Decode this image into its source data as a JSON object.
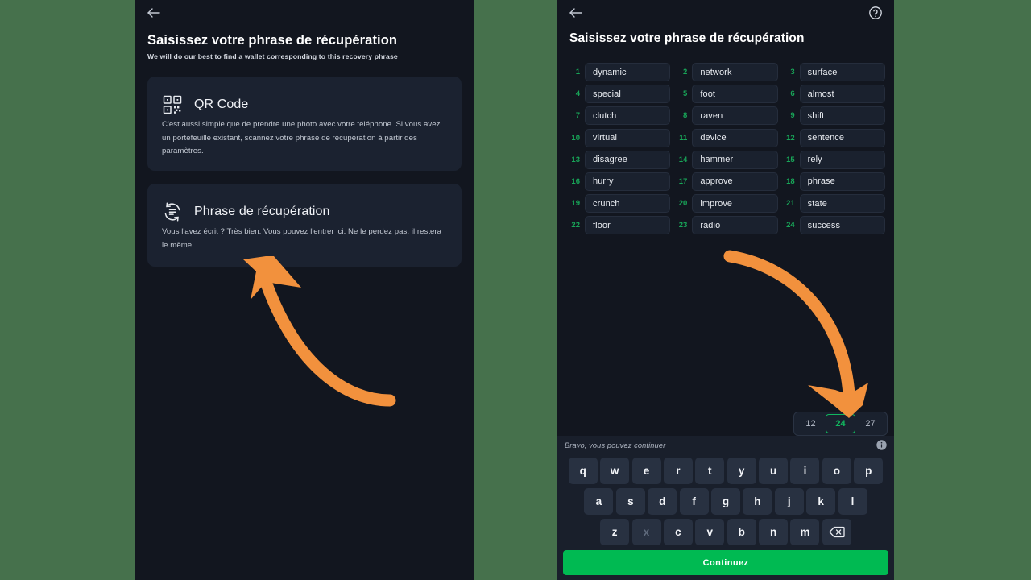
{
  "theme": {
    "background": "#46714c",
    "panel_bg": "#12161f",
    "card_bg": "#1b2230",
    "accent_green": "#00ba52",
    "number_green": "#18a558",
    "annotation_orange": "#f2913d",
    "key_bg": "#283141"
  },
  "left_panel": {
    "back_icon": "back-arrow-icon",
    "title": "Saisissez votre phrase de récupération",
    "subtitle": "We will do our best to find a wallet corresponding to this recovery phrase",
    "cards": [
      {
        "icon": "qr-code-icon",
        "title": "QR Code",
        "body": "C'est aussi simple que de prendre une photo avec votre téléphone. Si vous avez un portefeuille existant, scannez votre phrase de récupération à partir des paramètres."
      },
      {
        "icon": "recovery-phrase-icon",
        "title": "Phrase de récupération",
        "body": "Vous l'avez écrit ? Très bien. Vous pouvez l'entrer ici. Ne le perdez pas, il restera le même."
      }
    ]
  },
  "right_panel": {
    "back_icon": "back-arrow-icon",
    "help_icon": "help-circle-icon",
    "title": "Saisissez votre phrase de récupération",
    "words": [
      {
        "num": "1",
        "word": "dynamic"
      },
      {
        "num": "2",
        "word": "network"
      },
      {
        "num": "3",
        "word": "surface"
      },
      {
        "num": "4",
        "word": "special"
      },
      {
        "num": "5",
        "word": "foot"
      },
      {
        "num": "6",
        "word": "almost"
      },
      {
        "num": "7",
        "word": "clutch"
      },
      {
        "num": "8",
        "word": "raven"
      },
      {
        "num": "9",
        "word": "shift"
      },
      {
        "num": "10",
        "word": "virtual"
      },
      {
        "num": "11",
        "word": "device"
      },
      {
        "num": "12",
        "word": "sentence"
      },
      {
        "num": "13",
        "word": "disagree"
      },
      {
        "num": "14",
        "word": "hammer"
      },
      {
        "num": "15",
        "word": "rely"
      },
      {
        "num": "16",
        "word": "hurry"
      },
      {
        "num": "17",
        "word": "approve"
      },
      {
        "num": "18",
        "word": "phrase"
      },
      {
        "num": "19",
        "word": "crunch"
      },
      {
        "num": "20",
        "word": "improve"
      },
      {
        "num": "21",
        "word": "state"
      },
      {
        "num": "22",
        "word": "floor"
      },
      {
        "num": "23",
        "word": "radio"
      },
      {
        "num": "24",
        "word": "success"
      }
    ],
    "word_count_options": [
      {
        "label": "12",
        "selected": false
      },
      {
        "label": "24",
        "selected": true
      },
      {
        "label": "27",
        "selected": false
      }
    ]
  },
  "keyboard": {
    "suggestion": "Bravo, vous pouvez continuer",
    "info_icon": "info-circle-icon",
    "row1": [
      "q",
      "w",
      "e",
      "r",
      "t",
      "y",
      "u",
      "i",
      "o",
      "p"
    ],
    "row2": [
      "a",
      "s",
      "d",
      "f",
      "g",
      "h",
      "j",
      "k",
      "l"
    ],
    "row3": [
      "z",
      "x",
      "c",
      "v",
      "b",
      "n",
      "m"
    ],
    "disabled_keys": [
      "x"
    ],
    "backspace_icon": "backspace-icon",
    "continue_label": "Continuez"
  },
  "annotations": [
    {
      "name": "arrow-to-recovery-phrase-card",
      "color": "#f2913d"
    },
    {
      "name": "arrow-to-word-count-24",
      "color": "#f2913d"
    }
  ]
}
